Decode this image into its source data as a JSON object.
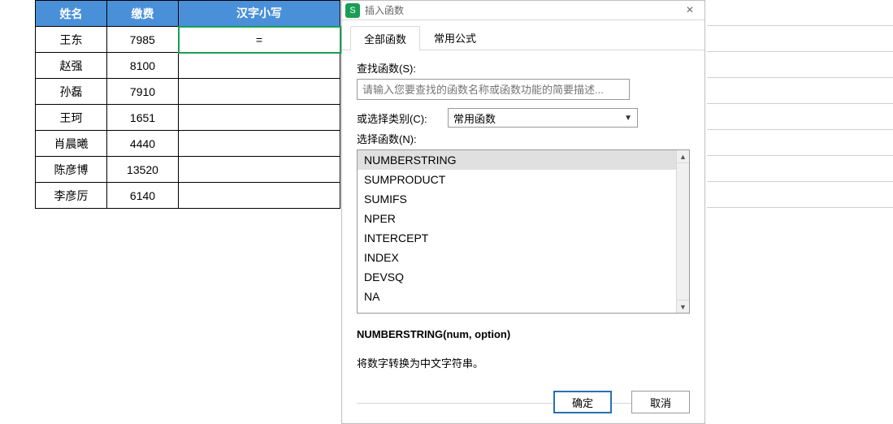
{
  "table": {
    "headers": {
      "name": "姓名",
      "fee": "缴费",
      "cn": "汉字小写"
    },
    "rows": [
      {
        "name": "王东",
        "fee": "7985",
        "cn": "="
      },
      {
        "name": "赵强",
        "fee": "8100",
        "cn": ""
      },
      {
        "name": "孙磊",
        "fee": "7910",
        "cn": ""
      },
      {
        "name": "王珂",
        "fee": "1651",
        "cn": ""
      },
      {
        "name": "肖晨曦",
        "fee": "4440",
        "cn": ""
      },
      {
        "name": "陈彦博",
        "fee": "13520",
        "cn": ""
      },
      {
        "name": "李彦厉",
        "fee": "6140",
        "cn": ""
      }
    ]
  },
  "dialog": {
    "title": "插入函数",
    "app_icon": "S",
    "tabs": {
      "all": "全部函数",
      "common": "常用公式"
    },
    "search_label": "查找函数(S):",
    "search_placeholder": "请输入您要查找的函数名称或函数功能的简要描述...",
    "category_label": "或选择类别(C):",
    "category_value": "常用函数",
    "list_label": "选择函数(N):",
    "functions": [
      "NUMBERSTRING",
      "SUMPRODUCT",
      "SUMIFS",
      "NPER",
      "INTERCEPT",
      "INDEX",
      "DEVSQ",
      "NA"
    ],
    "signature": "NUMBERSTRING(num, option)",
    "description": "将数字转换为中文字符串。",
    "ok": "确定",
    "cancel": "取消"
  }
}
